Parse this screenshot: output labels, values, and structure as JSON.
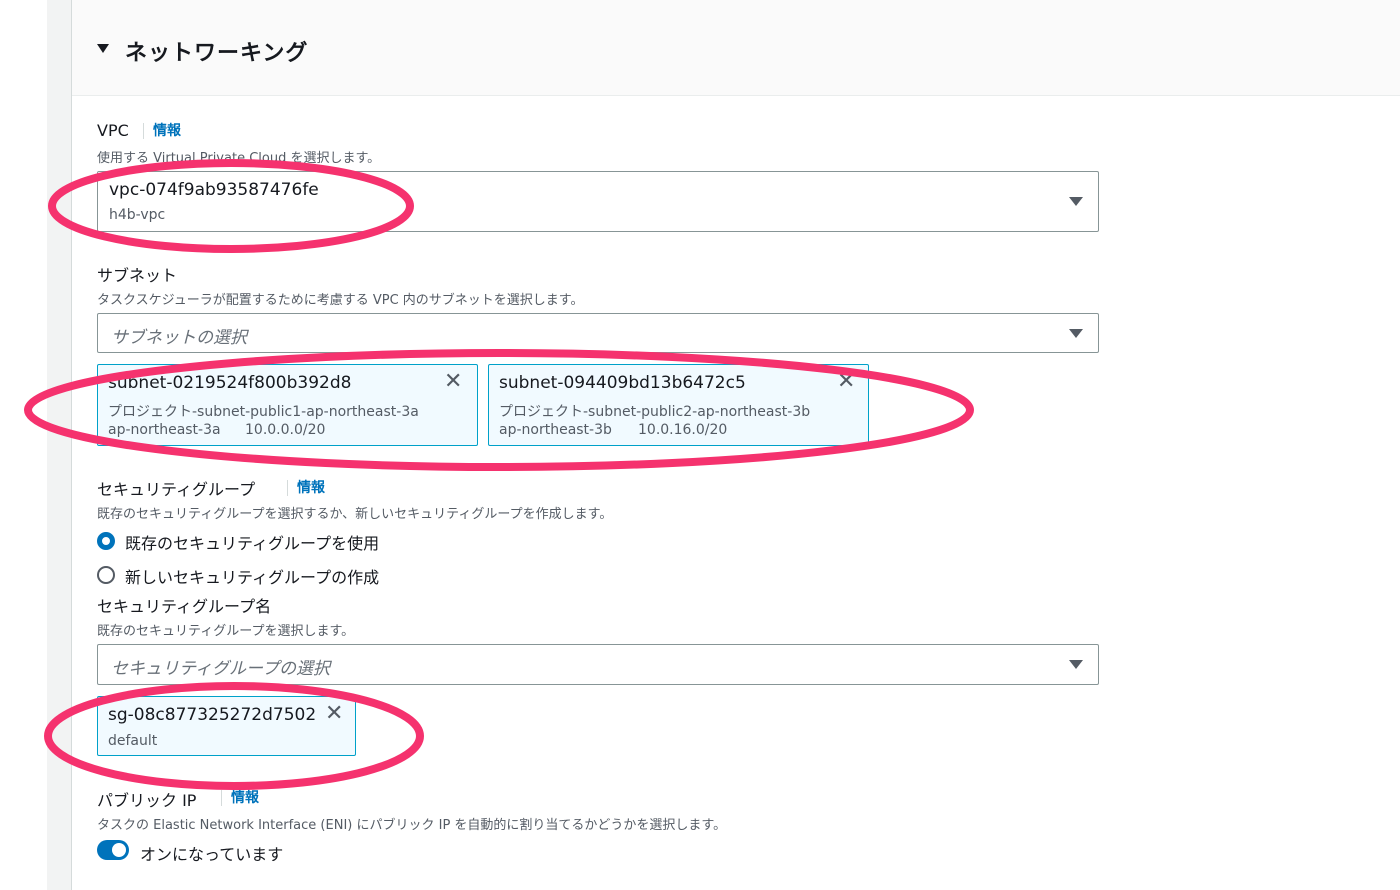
{
  "section": {
    "title": "ネットワーキング"
  },
  "vpc": {
    "label": "VPC",
    "info": "情報",
    "description": "使用する Virtual Private Cloud を選択します。",
    "selected_id": "vpc-074f9ab93587476fe",
    "selected_name": "h4b-vpc"
  },
  "subnet": {
    "label": "サブネット",
    "description": "タスクスケジューラが配置するために考慮する VPC 内のサブネットを選択します。",
    "placeholder": "サブネットの選択",
    "tokens": [
      {
        "id": "subnet-0219524f800b392d8",
        "name": "プロジェクト-subnet-public1-ap-northeast-3a",
        "az": "ap-northeast-3a",
        "cidr": "10.0.0.0/20"
      },
      {
        "id": "subnet-094409bd13b6472c5",
        "name": "プロジェクト-subnet-public2-ap-northeast-3b",
        "az": "ap-northeast-3b",
        "cidr": "10.0.16.0/20"
      }
    ]
  },
  "security_group": {
    "label": "セキュリティグループ",
    "info": "情報",
    "description": "既存のセキュリティグループを選択するか、新しいセキュリティグループを作成します。",
    "options": [
      "既存のセキュリティグループを使用",
      "新しいセキュリティグループの作成"
    ],
    "selected_option": "既存のセキュリティグループを使用",
    "name_label": "セキュリティグループ名",
    "name_description": "既存のセキュリティグループを選択します。",
    "placeholder": "セキュリティグループの選択",
    "tokens": [
      {
        "id": "sg-08c877325272d7502",
        "name": "default"
      }
    ]
  },
  "public_ip": {
    "label": "パブリック IP",
    "info": "情報",
    "description": "タスクの Elastic Network Interface (ENI) にパブリック IP を自動的に割り当てるかどうかを選択します。",
    "toggle_label": "オンになっています",
    "enabled": true
  },
  "colors": {
    "accent": "#0073bb",
    "annotation": "#f5326e",
    "token_border": "#00a1c9"
  },
  "icons": {
    "collapse": "caret-down-icon",
    "dropdown": "triangle-down-icon",
    "remove": "close-x-icon"
  }
}
